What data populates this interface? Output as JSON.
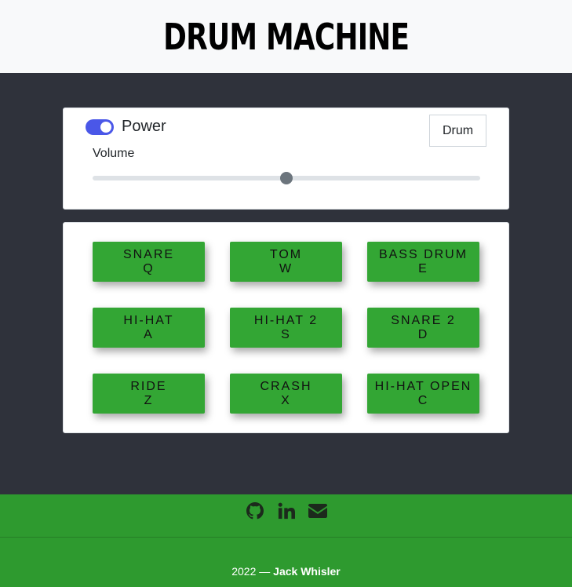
{
  "header": {
    "title": "DRUM MACHINE"
  },
  "controls": {
    "power_label": "Power",
    "power_on": true,
    "display_text": "Drum",
    "volume_label": "Volume",
    "volume_value": 0.5
  },
  "pads": [
    {
      "name": "SNARE",
      "key": "Q"
    },
    {
      "name": "TOM",
      "key": "W"
    },
    {
      "name": "BASS DRUM",
      "key": "E"
    },
    {
      "name": "HI-HAT",
      "key": "A"
    },
    {
      "name": "HI-HAT 2",
      "key": "S"
    },
    {
      "name": "SNARE 2",
      "key": "D"
    },
    {
      "name": "RIDE",
      "key": "Z"
    },
    {
      "name": "CRASH",
      "key": "X"
    },
    {
      "name": "HI-HAT OPEN",
      "key": "C"
    }
  ],
  "footer": {
    "icons": [
      "github-icon",
      "linkedin-icon",
      "envelope-icon"
    ],
    "year": "2022",
    "separator": "—",
    "author": "Jack Whisler"
  },
  "colors": {
    "background": "#2f323b",
    "pad": "#33a634",
    "footer": "#2e9a2f",
    "toggle": "#4a57e8"
  }
}
